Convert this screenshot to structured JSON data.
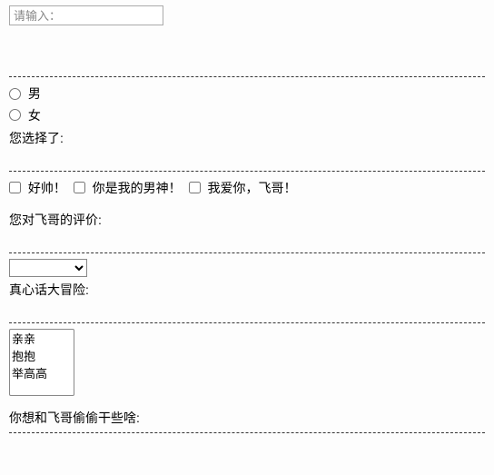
{
  "input": {
    "placeholder": "请输入："
  },
  "gender": {
    "options": [
      "男",
      "女"
    ],
    "result_label": "您选择了:"
  },
  "praise": {
    "options": [
      "好帅！",
      "你是我的男神！",
      "我爱你，飞哥！"
    ],
    "result_label": "您对飞哥的评价:"
  },
  "truthdare": {
    "selected": "",
    "result_label": "真心话大冒险:"
  },
  "actions": {
    "options": [
      "亲亲",
      "抱抱",
      "举高高"
    ],
    "result_label": "你想和飞哥偷偷干些啥:"
  }
}
